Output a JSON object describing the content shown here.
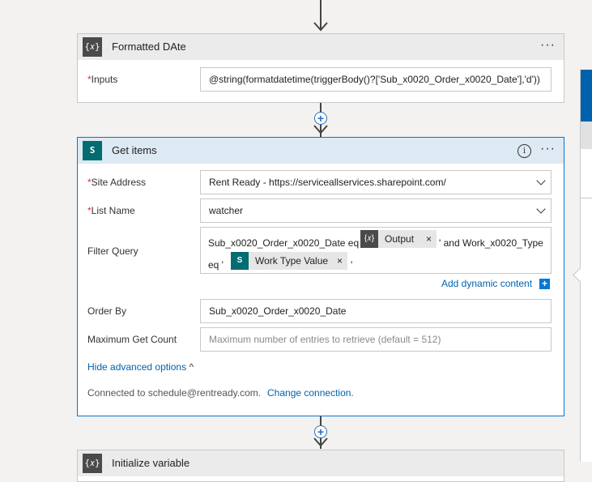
{
  "formatted_card": {
    "icon": "{𝑥}",
    "title": "Formatted DAte",
    "more": "···",
    "inputs_label": "Inputs",
    "required_mark": "*",
    "inputs_value": "@string(formatdatetime(triggerBody()?['Sub_x0020_Order_x0020_Date'],'d'))"
  },
  "get_items_card": {
    "icon": "S",
    "title": "Get items",
    "info": "i",
    "more": "···",
    "site_address_label": "Site Address",
    "site_address_value": "Rent Ready - https://serviceallservices.sharepoint.com/",
    "list_name_label": "List Name",
    "list_name_value": "watcher",
    "filter_query_label": "Filter Query",
    "filter": {
      "part1": "Sub_x0020_Order_x0020_Date eq '",
      "token1_icon": "{𝑥}",
      "token1_label": "Output",
      "part2": "' and Work_x0020_Type",
      "part3": "eq '",
      "token2_icon": "S",
      "token2_label": "Work Type Value",
      "part4": "'",
      "remove": "×"
    },
    "add_dynamic": "Add dynamic content",
    "add_dynamic_plus": "+",
    "order_by_label": "Order By",
    "order_by_value": "Sub_x0020_Order_x0020_Date",
    "max_count_label": "Maximum Get Count",
    "max_count_placeholder": "Maximum number of entries to retrieve (default = 512)",
    "hide_advanced": "Hide advanced options",
    "hide_advanced_caret": "^",
    "connected_to": "Connected to schedule@rentready.com.",
    "change_connection": "Change connection."
  },
  "next_card": {
    "icon": "{𝑥}",
    "title": "Initialize variable"
  },
  "insert_step": "+",
  "colors": {
    "accent": "#0078d4",
    "sharepoint": "#036c70",
    "link": "#0062ad",
    "required": "#d13438"
  }
}
